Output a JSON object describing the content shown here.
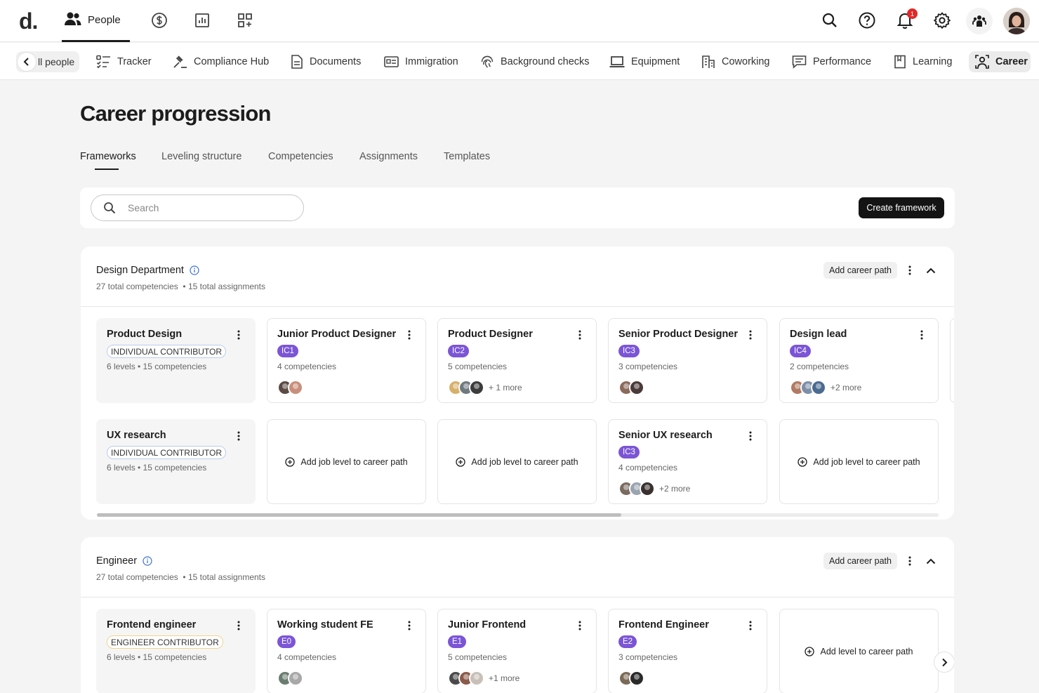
{
  "topbar": {
    "logo": "d.",
    "people_label": "People",
    "notification_count": "1"
  },
  "subnav": {
    "back_label": "ll people",
    "items": [
      {
        "label": "Tracker"
      },
      {
        "label": "Compliance Hub"
      },
      {
        "label": "Documents"
      },
      {
        "label": "Immigration"
      },
      {
        "label": "Background checks"
      },
      {
        "label": "Equipment"
      },
      {
        "label": "Coworking"
      },
      {
        "label": "Performance"
      },
      {
        "label": "Learning"
      }
    ],
    "active_label": "Career"
  },
  "page": {
    "title": "Career progression",
    "tabs": [
      "Frameworks",
      "Leveling structure",
      "Competencies",
      "Assignments",
      "Templates"
    ],
    "search_placeholder": "Search",
    "create_label": "Create framework"
  },
  "departments": [
    {
      "name": "Design Department",
      "competencies": "27 total competencies",
      "assignments": "• 15 total assignments",
      "add_path_label": "Add career path",
      "rows": [
        {
          "path": {
            "title": "Product Design",
            "badge": "INDIVIDUAL CONTRIBUTOR",
            "meta": "6 levels • 15 competencies"
          },
          "levels": [
            {
              "title": "Junior Product Designer",
              "badge": "IC1",
              "meta": "4 competencies",
              "more": "",
              "avatars": [
                "#5a4a44",
                "#c98f7a"
              ]
            },
            {
              "title": "Product Designer",
              "badge": "IC2",
              "meta": "5 competencies",
              "more": "+ 1 more",
              "avatars": [
                "#d7b06a",
                "#6f7a80",
                "#3c3c3c"
              ]
            },
            {
              "title": "Senior Product Designer",
              "badge": "IC3",
              "meta": "3 competencies",
              "more": "",
              "avatars": [
                "#8a6a5a",
                "#4a3a3a"
              ]
            },
            {
              "title": "Design lead",
              "badge": "IC4",
              "meta": "2 competencies",
              "more": "+2 more",
              "avatars": [
                "#b07a62",
                "#7d8fa8",
                "#4b6b8f"
              ]
            }
          ]
        },
        {
          "path": {
            "title": "UX research",
            "badge": "INDIVIDUAL CONTRIBUTOR",
            "meta": "6 levels • 15 competencies"
          },
          "levels": [
            {
              "add_label": "Add job level to career path"
            },
            {
              "add_label": "Add job level to career path"
            },
            {
              "title": "Senior UX research",
              "badge": "IC3",
              "meta": "4 competencies",
              "more": "+2 more",
              "avatars": [
                "#7a6a60",
                "#9aa4b0",
                "#3a3030"
              ]
            },
            {
              "add_label": "Add job level to career path"
            }
          ]
        }
      ]
    },
    {
      "name": "Engineer",
      "competencies": "27 total competencies",
      "assignments": "• 15 total assignments",
      "add_path_label": "Add career path",
      "rows": [
        {
          "path": {
            "title": "Frontend engineer",
            "badge": "ENGINEER CONTRIBUTOR",
            "meta": "6 levels • 15 competencies"
          },
          "levels": [
            {
              "title": "Working student FE",
              "badge": "E0",
              "meta": "4 competencies",
              "more": "",
              "avatars": [
                "#6b7d70",
                "#a8a8a8"
              ]
            },
            {
              "title": "Junior Frontend",
              "badge": "E1",
              "meta": "5 competencies",
              "more": "+1 more",
              "avatars": [
                "#4a4a4a",
                "#8a5a4a",
                "#c8c0b8"
              ]
            },
            {
              "title": "Frontend Engineer",
              "badge": "E2",
              "meta": "3 competencies",
              "more": "",
              "avatars": [
                "#7a6a58",
                "#2a2a2a"
              ]
            },
            {
              "add_label": "Add level to career path"
            }
          ]
        }
      ]
    }
  ]
}
